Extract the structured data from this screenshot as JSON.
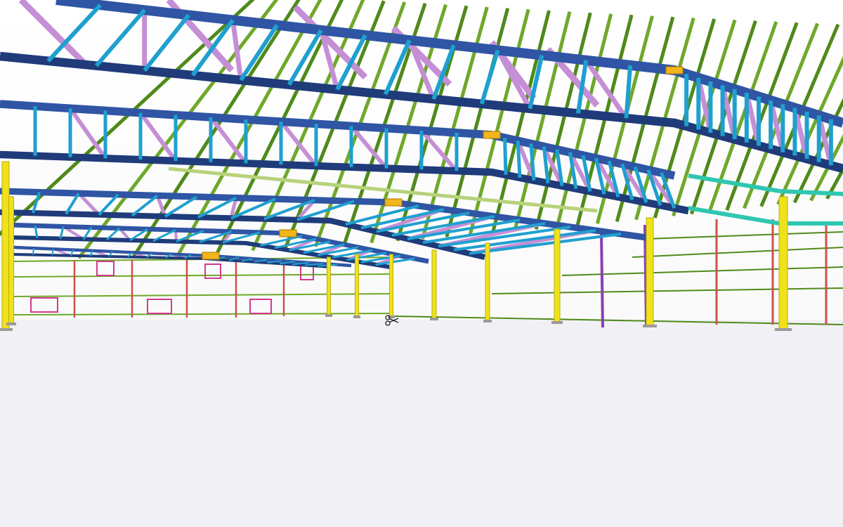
{
  "viewport": {
    "description_name": "3d-structural-model-view",
    "cursor_icon": "scissors-cursor-icon"
  },
  "colors": {
    "background": "#ffffff",
    "floor": "#f1f1f5",
    "rafter_blue": "#2f55a4",
    "rafter_blue_dark": "#1f3b7a",
    "web_cyan": "#1ea0d0",
    "diagonal_purple": "#c58fd6",
    "purlin_green": "#6fa82a",
    "purlin_green_dark": "#4f8a1a",
    "column_yellow": "#f0e21a",
    "column_yellow_dark": "#b9ad10",
    "girt_red": "#d0504a",
    "girt_magenta": "#d23a8e",
    "brace_pink": "#d96ab8",
    "connection_orange": "#f2b51a",
    "ridge_teal": "#2fc7b0",
    "light_green_tie": "#b7d27a",
    "purple_post": "#8a3fb0"
  }
}
